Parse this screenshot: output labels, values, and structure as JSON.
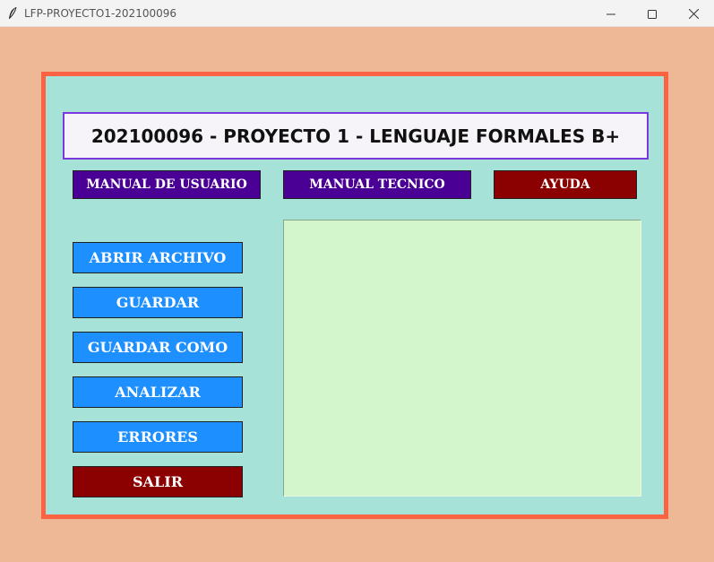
{
  "window": {
    "title": "LFP-PROYECTO1-202100096"
  },
  "heading": "202100096 - PROYECTO 1 - LENGUAJE FORMALES B+",
  "top_buttons": {
    "manual_usuario": "MANUAL DE USUARIO",
    "manual_tecnico": "MANUAL TECNICO",
    "ayuda": "AYUDA"
  },
  "side_buttons": {
    "abrir": "ABRIR ARCHIVO",
    "guardar": "GUARDAR",
    "guardar_como": "GUARDAR COMO",
    "analizar": "ANALIZAR",
    "errores": "ERRORES",
    "salir": "SALIR"
  },
  "editor": {
    "content": ""
  },
  "colors": {
    "window_background": "#eeb897",
    "frame_border": "#fb6343",
    "frame_fill": "#a6e2d8",
    "heading_border": "#7a39db",
    "purple_button": "#4b0095",
    "dark_red_button": "#8b0000",
    "blue_button": "#1e8ffe",
    "editor_fill": "#d3f6cc"
  },
  "icons": {
    "app": "feather-icon",
    "minimize": "minimize-icon",
    "maximize": "maximize-icon",
    "close": "close-icon"
  }
}
